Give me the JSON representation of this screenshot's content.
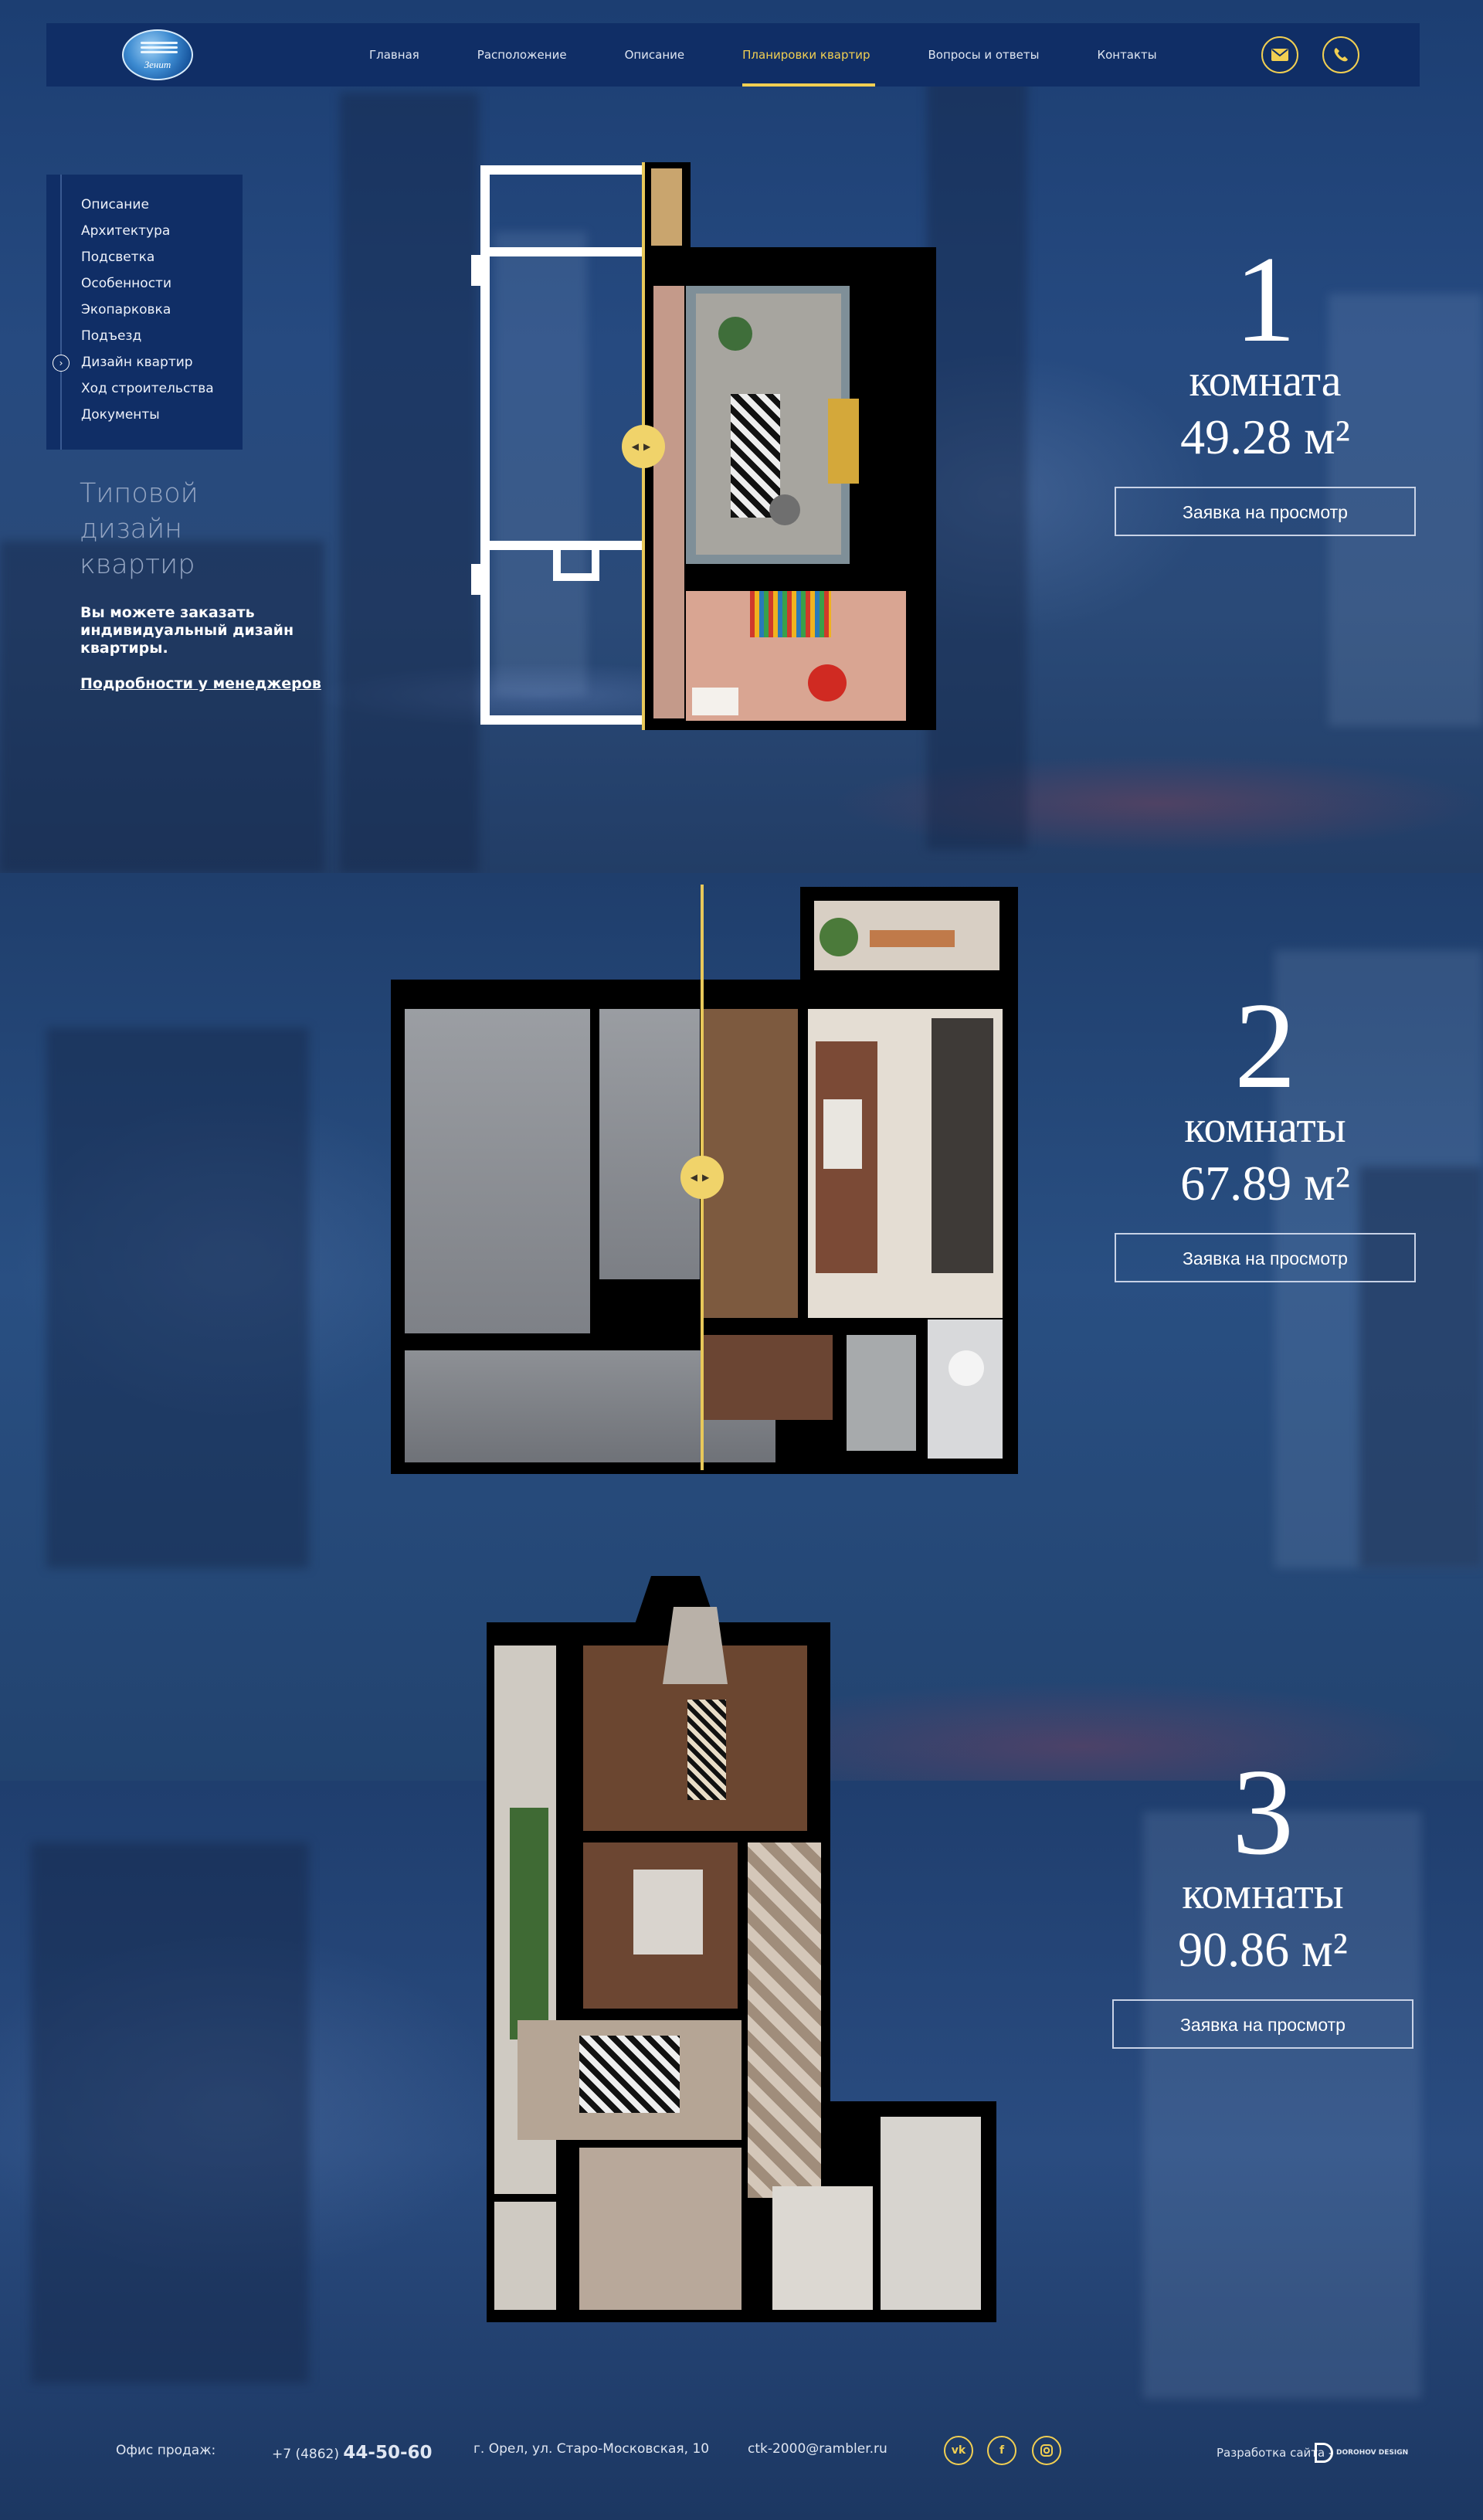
{
  "header": {
    "logo_text": "Зенит",
    "nav": [
      {
        "label": "Главная",
        "active": false
      },
      {
        "label": "Расположение",
        "active": false
      },
      {
        "label": "Описание",
        "active": false
      },
      {
        "label": "Планировки квартир",
        "active": true
      },
      {
        "label": "Вопросы и ответы",
        "active": false
      },
      {
        "label": "Контакты",
        "active": false
      }
    ],
    "icons": [
      "mail-icon",
      "phone-icon"
    ],
    "accent_color": "#f1cf52"
  },
  "sidebar": {
    "items": [
      {
        "label": "Описание"
      },
      {
        "label": "Архитектура"
      },
      {
        "label": "Подсветка"
      },
      {
        "label": "Особенности"
      },
      {
        "label": "Экопарковка"
      },
      {
        "label": "Подъезд"
      },
      {
        "label": "Дизайн квартир",
        "active": true
      },
      {
        "label": "Ход строительства"
      },
      {
        "label": "Документы"
      }
    ],
    "title": "Типовой дизайн квартир",
    "note": "Вы можете заказать индивидуальный дизайн квартиры.",
    "link": "Подробности у менеджеров"
  },
  "plans": [
    {
      "rooms_num": "1",
      "rooms_label": "комната",
      "area": "49.28 м²",
      "button": "Заявка на просмотр"
    },
    {
      "rooms_num": "2",
      "rooms_label": "комнаты",
      "area": "67.89 м²",
      "button": "Заявка на просмотр"
    },
    {
      "rooms_num": "3",
      "rooms_label": "комнаты",
      "area": "90.86 м²",
      "button": "Заявка на просмотр"
    }
  ],
  "footer": {
    "office_label": "Офис продаж:",
    "phone_prefix": "+7 (4862)",
    "phone_number": "44-50-60",
    "address": "г. Орел, ул. Старо-Московская, 10",
    "email": "ctk-2000@rambler.ru",
    "social": [
      "vk-icon",
      "facebook-icon",
      "instagram-icon"
    ],
    "developer_label": "Разработка сайта -",
    "developer_logo_text": "DOROHOV DESIGN"
  }
}
